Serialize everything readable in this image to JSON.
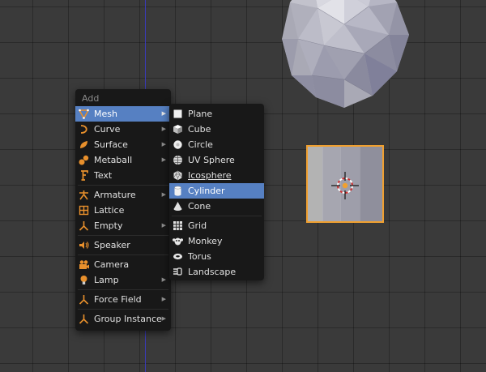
{
  "add_menu": {
    "title": "Add",
    "items": [
      {
        "label": "Mesh",
        "icon": "mesh-icon",
        "submenu": true
      },
      {
        "label": "Curve",
        "icon": "curve-icon",
        "submenu": true
      },
      {
        "label": "Surface",
        "icon": "surface-icon",
        "submenu": true
      },
      {
        "label": "Metaball",
        "icon": "metaball-icon",
        "submenu": true
      },
      {
        "label": "Text",
        "icon": "text-icon",
        "submenu": false
      },
      {
        "label": "Armature",
        "icon": "armature-icon",
        "submenu": true
      },
      {
        "label": "Lattice",
        "icon": "lattice-icon",
        "submenu": false
      },
      {
        "label": "Empty",
        "icon": "empty-icon",
        "submenu": true
      },
      {
        "label": "Speaker",
        "icon": "speaker-icon",
        "submenu": false
      },
      {
        "label": "Camera",
        "icon": "camera-icon",
        "submenu": false
      },
      {
        "label": "Lamp",
        "icon": "lamp-icon",
        "submenu": true
      },
      {
        "label": "Force Field",
        "icon": "force-field-icon",
        "submenu": true
      },
      {
        "label": "Group Instance",
        "icon": "group-instance-icon",
        "submenu": true
      }
    ],
    "arrow_glyph": "▶"
  },
  "mesh_menu": {
    "items": [
      {
        "label": "Plane",
        "icon": "plane-icon"
      },
      {
        "label": "Cube",
        "icon": "cube-icon"
      },
      {
        "label": "Circle",
        "icon": "circle-icon"
      },
      {
        "label": "UV Sphere",
        "icon": "uv-sphere-icon"
      },
      {
        "label": "Icosphere",
        "icon": "icosphere-icon"
      },
      {
        "label": "Cylinder",
        "icon": "cylinder-icon",
        "active": true
      },
      {
        "label": "Cone",
        "icon": "cone-icon"
      },
      {
        "label": "Grid",
        "icon": "grid-icon"
      },
      {
        "label": "Monkey",
        "icon": "monkey-icon"
      },
      {
        "label": "Torus",
        "icon": "torus-icon"
      },
      {
        "label": "Landscape",
        "icon": "landscape-icon"
      }
    ]
  },
  "colors": {
    "highlight": "#5680c2",
    "selection_outline": "#f0a030",
    "icon_orange": "#e8902c",
    "menu_bg": "#181818",
    "viewport_bg": "#3a3a3a"
  }
}
